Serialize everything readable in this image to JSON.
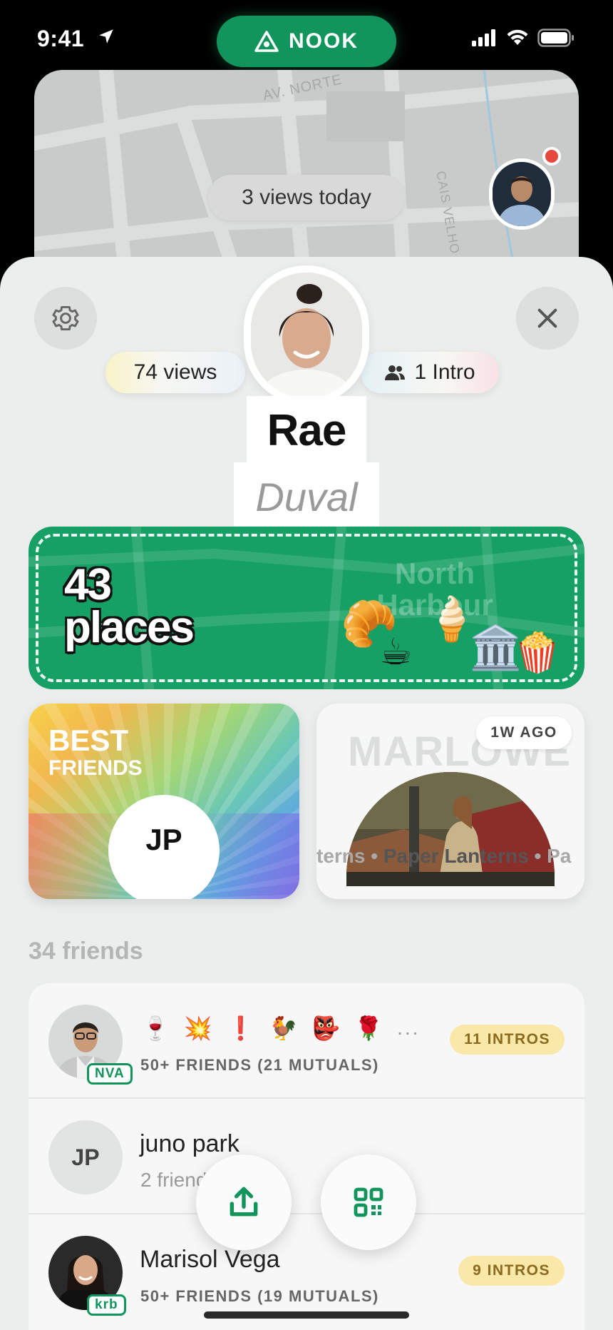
{
  "status_bar": {
    "time": "9:41"
  },
  "brand": {
    "name": "NOOK"
  },
  "map": {
    "street_1": "AV. NORTE",
    "street_2": "CAIS VELHO",
    "views_today": "3 views today"
  },
  "profile": {
    "views": "74 views",
    "intros": "1 Intro",
    "first_name": "Rae",
    "last_name": "Duval"
  },
  "places": {
    "count_line": "43",
    "count_label": "places",
    "area_line_1": "North",
    "area_line_2": "Harbour",
    "emojis": [
      "🥐",
      "☕",
      "🍦",
      "🏛️",
      "🍿"
    ]
  },
  "best_friends": {
    "title": "BEST",
    "subtitle": "FRIENDS",
    "initials": "JP"
  },
  "music": {
    "artist": "MARLOWE",
    "ago": "1W AGO",
    "marquee_prev": "terns",
    "marquee_sep": "•",
    "marquee_current": "Paper Lanterns",
    "marquee_next": "Pa"
  },
  "friends": {
    "count": "34 friends",
    "rows": [
      {
        "tag": "NVA",
        "emojis": [
          "🍷",
          "💥",
          "❗",
          "🐓",
          "👺",
          "🌹"
        ],
        "more": "...",
        "sub": "50+ FRIENDS (21 MUTUALS)",
        "intros": "11 INTROS"
      },
      {
        "initials": "JP",
        "name": "juno park",
        "sub": "2 friends"
      },
      {
        "tag": "krb",
        "name": "Marisol Vega",
        "sub": "50+ FRIENDS (19 MUTUALS)",
        "intros": "9 INTROS"
      }
    ]
  },
  "colors": {
    "brand_green": "#12955c",
    "places_green": "#16a065",
    "intro_badge": "#f9e8a8",
    "notification_red": "#e6483d"
  },
  "icons": [
    "location-arrow-icon",
    "nook-logo-icon",
    "signal-icon",
    "wifi-icon",
    "battery-icon",
    "gear-icon",
    "close-icon",
    "people-icon",
    "share-icon",
    "qr-code-icon"
  ]
}
